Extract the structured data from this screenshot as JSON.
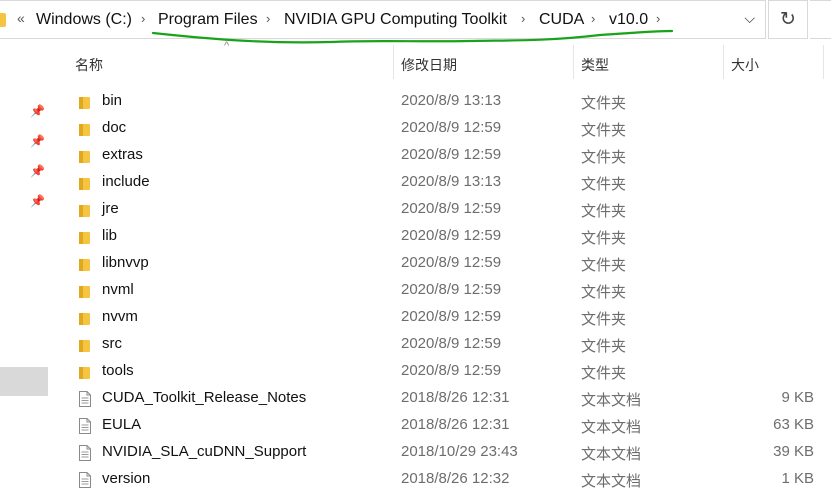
{
  "address_bar": {
    "overflow": "«",
    "breadcrumbs": [
      "Windows (C:)",
      "Program Files",
      "NVIDIA GPU Computing Toolkit",
      "CUDA",
      "v10.0"
    ],
    "dropdown_icon": "chevron-down-icon",
    "refresh_icon": "refresh-icon"
  },
  "annotation": {
    "color": "#1aa31a",
    "note": "hand-drawn green underline"
  },
  "columns": {
    "name": "名称",
    "date": "修改日期",
    "type": "类型",
    "size": "大小"
  },
  "files": [
    {
      "name": "bin",
      "date": "2020/8/9 13:13",
      "type": "文件夹",
      "size": "",
      "kind": "folder"
    },
    {
      "name": "doc",
      "date": "2020/8/9 12:59",
      "type": "文件夹",
      "size": "",
      "kind": "folder"
    },
    {
      "name": "extras",
      "date": "2020/8/9 12:59",
      "type": "文件夹",
      "size": "",
      "kind": "folder"
    },
    {
      "name": "include",
      "date": "2020/8/9 13:13",
      "type": "文件夹",
      "size": "",
      "kind": "folder"
    },
    {
      "name": "jre",
      "date": "2020/8/9 12:59",
      "type": "文件夹",
      "size": "",
      "kind": "folder"
    },
    {
      "name": "lib",
      "date": "2020/8/9 12:59",
      "type": "文件夹",
      "size": "",
      "kind": "folder"
    },
    {
      "name": "libnvvp",
      "date": "2020/8/9 12:59",
      "type": "文件夹",
      "size": "",
      "kind": "folder"
    },
    {
      "name": "nvml",
      "date": "2020/8/9 12:59",
      "type": "文件夹",
      "size": "",
      "kind": "folder"
    },
    {
      "name": "nvvm",
      "date": "2020/8/9 12:59",
      "type": "文件夹",
      "size": "",
      "kind": "folder"
    },
    {
      "name": "src",
      "date": "2020/8/9 12:59",
      "type": "文件夹",
      "size": "",
      "kind": "folder"
    },
    {
      "name": "tools",
      "date": "2020/8/9 12:59",
      "type": "文件夹",
      "size": "",
      "kind": "folder"
    },
    {
      "name": "CUDA_Toolkit_Release_Notes",
      "date": "2018/8/26 12:31",
      "type": "文本文档",
      "size": "9 KB",
      "kind": "file"
    },
    {
      "name": "EULA",
      "date": "2018/8/26 12:31",
      "type": "文本文档",
      "size": "63 KB",
      "kind": "file"
    },
    {
      "name": "NVIDIA_SLA_cuDNN_Support",
      "date": "2018/10/29 23:43",
      "type": "文本文档",
      "size": "39 KB",
      "kind": "file"
    },
    {
      "name": "version",
      "date": "2018/8/26 12:32",
      "type": "文本文档",
      "size": "1 KB",
      "kind": "file"
    }
  ],
  "colors": {
    "folder": "#f5c542",
    "folder_dark": "#e0a81e",
    "selected_nav": "#d9d9d9"
  }
}
